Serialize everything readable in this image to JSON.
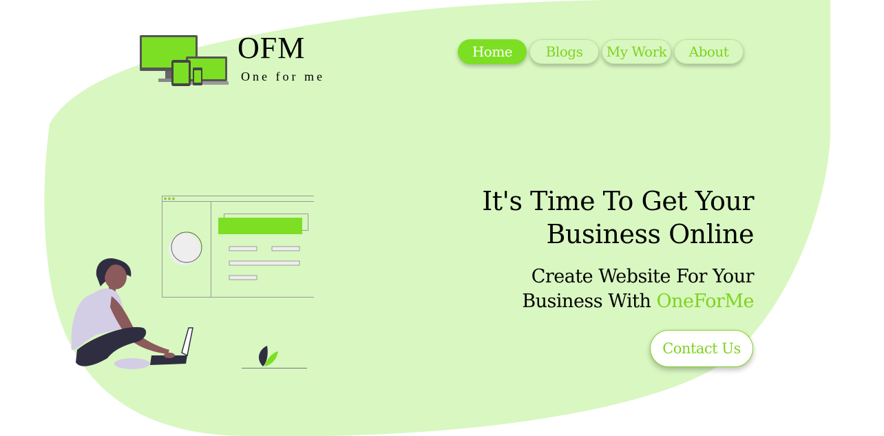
{
  "brand": {
    "title": "OFM",
    "tagline": "One for me",
    "logo_icon": "devices-icon"
  },
  "nav": {
    "items": [
      {
        "label": "Home",
        "active": true
      },
      {
        "label": "Blogs",
        "active": false
      },
      {
        "label": "My Work",
        "active": false
      },
      {
        "label": "About",
        "active": false
      }
    ]
  },
  "hero": {
    "title_line1": "It's Time To Get Your",
    "title_line2": "Business Online",
    "subtitle_line1": "Create Website For Your",
    "subtitle_line2_prefix": "Business With ",
    "subtitle_brand": "OneForMe",
    "cta_label": "Contact Us"
  },
  "illustration": {
    "icon": "person-with-laptop-website-mockup-icon"
  },
  "colors": {
    "accent": "#7ed320",
    "blob": "#d9f7c1",
    "accent_fill": "#7ddf24"
  }
}
